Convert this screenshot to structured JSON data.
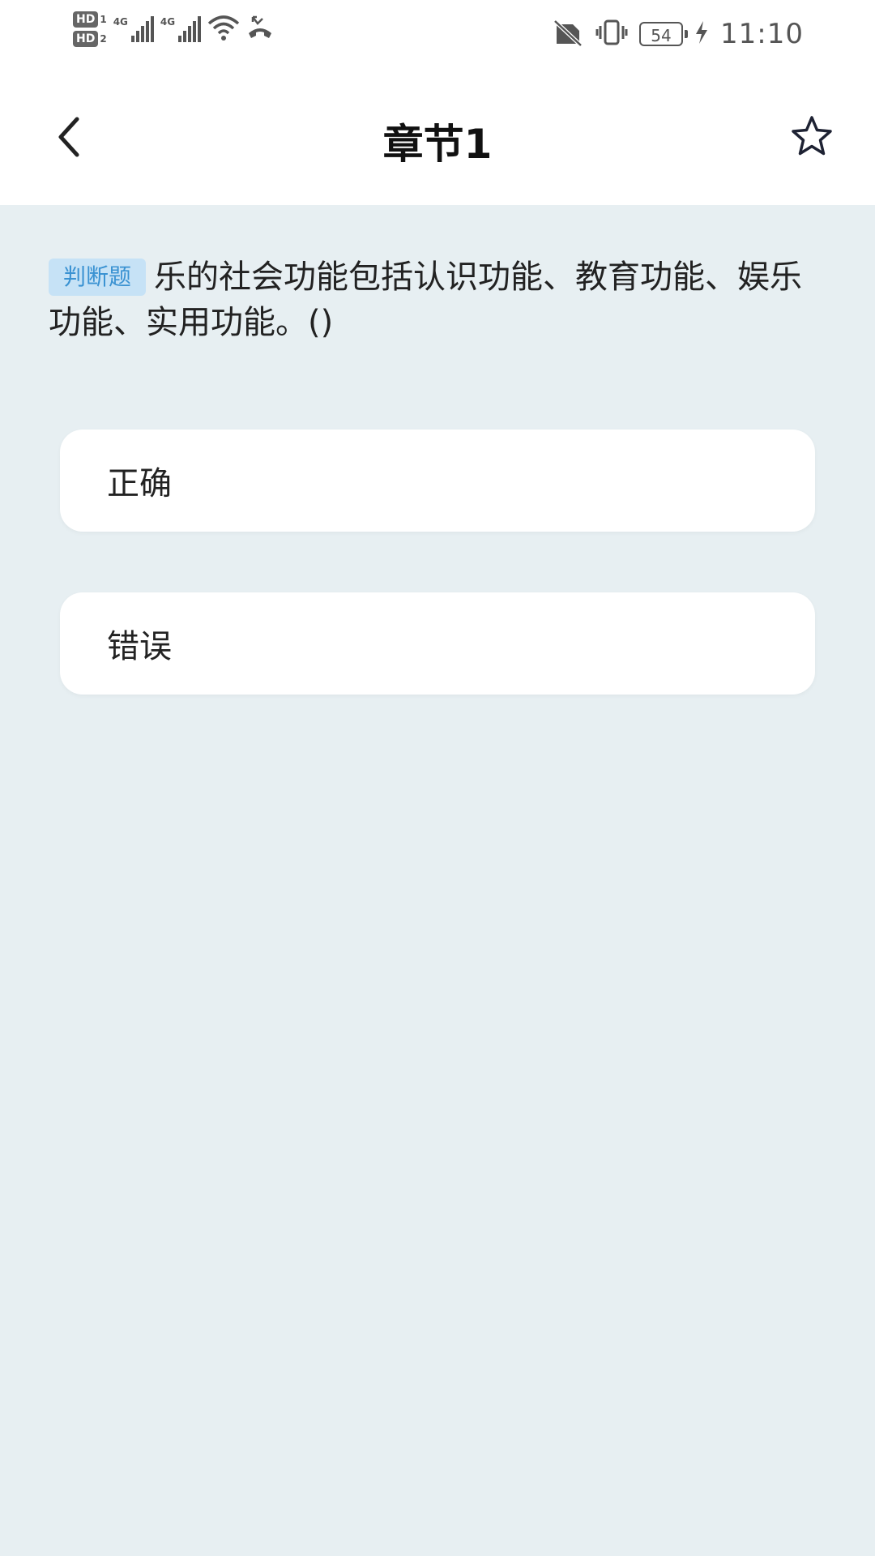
{
  "status_bar": {
    "time": "11:10",
    "battery": "54",
    "hd1_label": "HD",
    "hd1_num": "1",
    "hd2_label": "HD",
    "hd2_num": "2",
    "sim1_net": "4G",
    "sim2_net": "4G",
    "icons": [
      "wifi-icon",
      "missed-call-icon",
      "no-sim-icon",
      "vibrate-icon",
      "battery-icon",
      "charging-icon"
    ]
  },
  "header": {
    "title": "章节1",
    "back_icon": "chevron-left-icon",
    "favorite_icon": "star-outline-icon"
  },
  "question": {
    "type_label": "判断题",
    "text": "乐的社会功能包括认识功能、教育功能、娱乐功能、实用功能。()"
  },
  "options": [
    {
      "label": "正确"
    },
    {
      "label": "错误"
    }
  ],
  "colors": {
    "background": "#e7eff2",
    "tag_background": "#c6e2f6",
    "tag_text": "#3a92d2",
    "card": "#ffffff"
  }
}
